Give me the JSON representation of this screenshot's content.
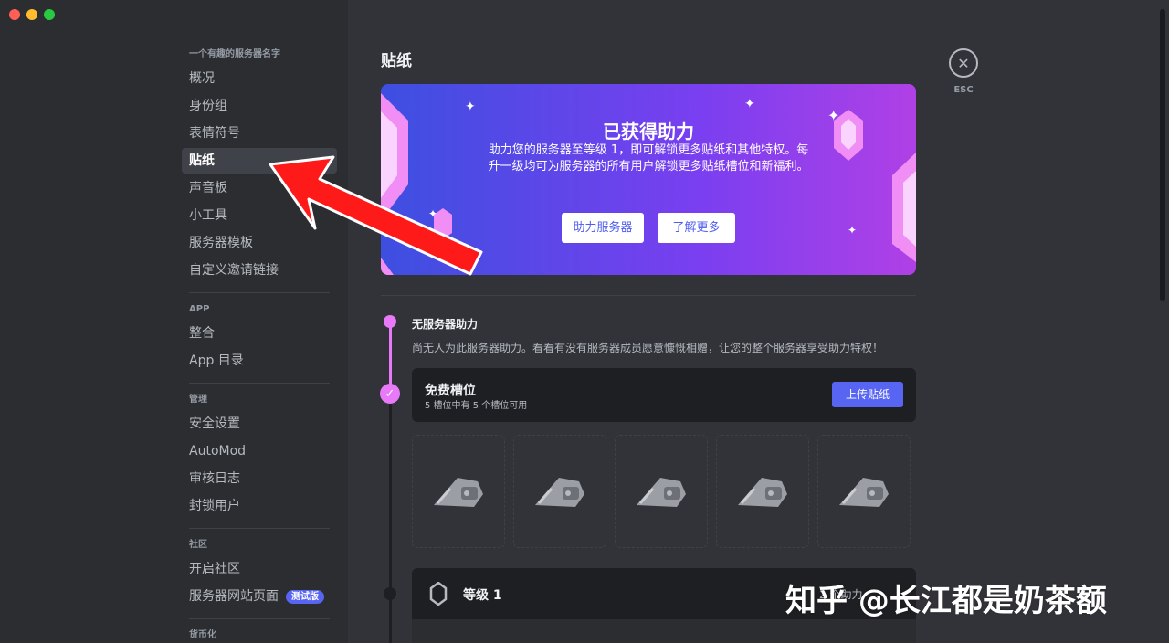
{
  "window": {
    "traffic_lights": {
      "close": "#ff5f57",
      "minimize": "#febc2e",
      "maximize": "#28c840"
    }
  },
  "sidebar": {
    "sections": [
      {
        "title": "一个有趣的服务器名字",
        "items": [
          {
            "label": "概况"
          },
          {
            "label": "身份组"
          },
          {
            "label": "表情符号"
          },
          {
            "label": "贴纸",
            "active": true
          },
          {
            "label": "声音板"
          },
          {
            "label": "小工具"
          },
          {
            "label": "服务器模板"
          },
          {
            "label": "自定义邀请链接"
          }
        ]
      },
      {
        "title": "APP",
        "items": [
          {
            "label": "整合"
          },
          {
            "label": "App 目录"
          }
        ]
      },
      {
        "title": "管理",
        "items": [
          {
            "label": "安全设置"
          },
          {
            "label": "AutoMod"
          },
          {
            "label": "审核日志"
          },
          {
            "label": "封锁用户"
          }
        ]
      },
      {
        "title": "社区",
        "items": [
          {
            "label": "开启社区"
          },
          {
            "label": "服务器网站页面",
            "badge": "测试版"
          }
        ]
      },
      {
        "title": "货币化",
        "items": []
      }
    ]
  },
  "main": {
    "title": "贴纸",
    "banner": {
      "title": "已获得助力",
      "description": "助力您的服务器至等级 1，即可解锁更多贴纸和其他特权。每升一级均可为服务器的所有用户解锁更多贴纸槽位和新福利。",
      "boost_button": "助力服务器",
      "learn_button": "了解更多"
    },
    "no_boost": {
      "title": "无服务器助力",
      "description": "尚无人为此服务器助力。看看有没有服务器成员愿意慷慨相赠，让您的整个服务器享受助力特权！"
    },
    "free_slots": {
      "title": "免费槽位",
      "subtitle": "5 槽位中有 5 个槽位可用",
      "upload_button": "上传贴纸",
      "slot_count": 5
    },
    "level1": {
      "title": "等级 1",
      "boost_text": "2 个助力"
    }
  },
  "esc": {
    "label": "ESC"
  },
  "watermark": "知乎 @长江都是奶茶额",
  "colors": {
    "accent": "#5865f2",
    "timeline_active": "#e879f9",
    "arrow": "#ff1a1a"
  }
}
